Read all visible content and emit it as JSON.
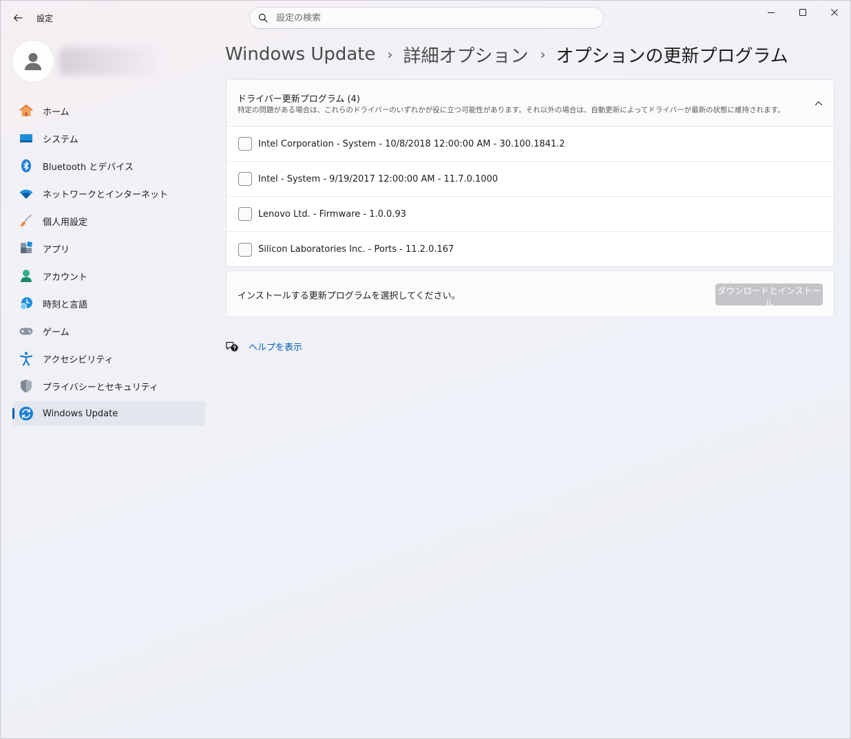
{
  "window": {
    "title": "設定",
    "controls": {
      "minimize": "minimize-icon",
      "maximize": "maximize-icon",
      "close": "close-icon"
    }
  },
  "search": {
    "placeholder": "設定の検索",
    "value": ""
  },
  "profile": {
    "avatar_icon": "person-icon"
  },
  "sidebar": {
    "items": [
      {
        "label": "ホーム",
        "icon": "home-icon",
        "active": false
      },
      {
        "label": "システム",
        "icon": "system-icon",
        "active": false
      },
      {
        "label": "Bluetooth とデバイス",
        "icon": "bluetooth-icon",
        "active": false
      },
      {
        "label": "ネットワークとインターネット",
        "icon": "wifi-icon",
        "active": false
      },
      {
        "label": "個人用設定",
        "icon": "brush-icon",
        "active": false
      },
      {
        "label": "アプリ",
        "icon": "apps-icon",
        "active": false
      },
      {
        "label": "アカウント",
        "icon": "account-icon",
        "active": false
      },
      {
        "label": "時刻と言語",
        "icon": "time-language-icon",
        "active": false
      },
      {
        "label": "ゲーム",
        "icon": "gamepad-icon",
        "active": false
      },
      {
        "label": "アクセシビリティ",
        "icon": "accessibility-icon",
        "active": false
      },
      {
        "label": "プライバシーとセキュリティ",
        "icon": "shield-icon",
        "active": false
      },
      {
        "label": "Windows Update",
        "icon": "windows-update-icon",
        "active": true
      }
    ]
  },
  "breadcrumb": {
    "items": [
      "Windows Update",
      "詳細オプション"
    ],
    "current": "オプションの更新プログラム"
  },
  "drivers": {
    "title": "ドライバー更新プログラム (4)",
    "description": "特定の問題がある場合は、これらのドライバーのいずれかが役に立つ可能性があります。それ以外の場合は、自動更新によってドライバーが最新の状態に維持されます。",
    "expanded": true,
    "items": [
      {
        "label": "Intel Corporation - System - 10/8/2018 12:00:00 AM - 30.100.1841.2",
        "checked": false
      },
      {
        "label": "Intel - System - 9/19/2017 12:00:00 AM - 11.7.0.1000",
        "checked": false
      },
      {
        "label": "Lenovo Ltd. - Firmware - 1.0.0.93",
        "checked": false
      },
      {
        "label": "Silicon Laboratories Inc. - Ports - 11.2.0.167",
        "checked": false
      }
    ]
  },
  "install": {
    "message": "インストールする更新プログラムを選択してください。",
    "button_label": "ダウンロードとインストール",
    "button_enabled": false
  },
  "help": {
    "label": "ヘルプを表示",
    "icon": "help-icon"
  },
  "colors": {
    "accent": "#005fb8",
    "disabled_button": "#c5c5c9"
  }
}
